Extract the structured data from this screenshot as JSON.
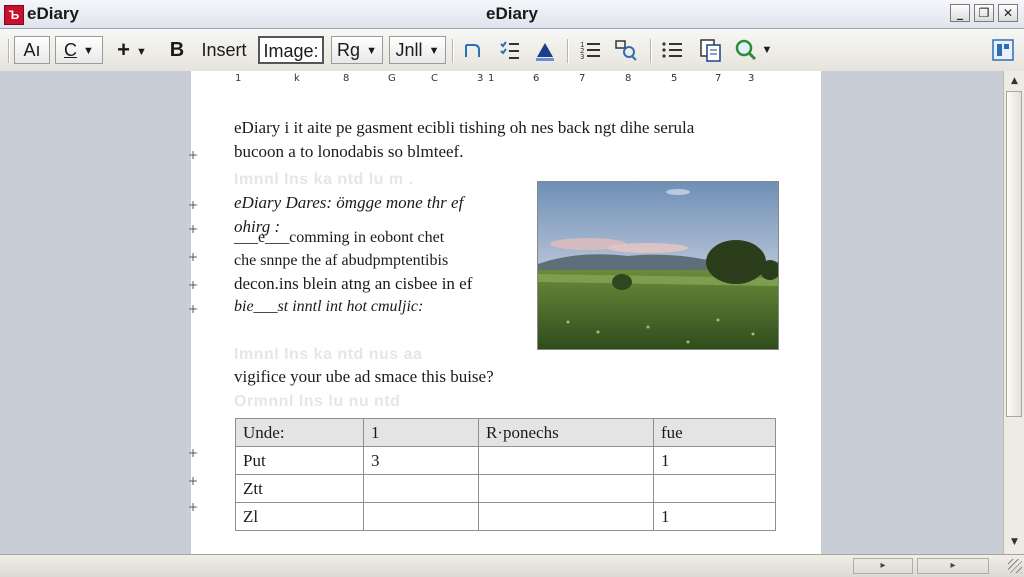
{
  "window": {
    "app_name": "eDiary",
    "title": "eDiary",
    "logo_glyph": "Ъ",
    "minimize": "_",
    "restore": "❐",
    "close": "✕"
  },
  "toolbar": {
    "font_button": "Aı",
    "style_select": "C",
    "add_button": "+",
    "bold_button": "B",
    "insert_label": "Insert",
    "image_button": "Image:",
    "rg_select": "Rg",
    "jnll_select": "Jnll"
  },
  "ruler": [
    "1",
    "k",
    "8",
    "G",
    "C",
    "3",
    "1",
    "6",
    "7",
    "8",
    "5",
    "7",
    "3"
  ],
  "document": {
    "para1_line1": "eDiary i it aite pe gasment ecibli tishing oh nes back ngt dihe serula",
    "para1_line2": "bucoon a to lonodabis so blmteef.",
    "ghost_line1": "Imnnl Ins  ka   ntd  lu m .",
    "para2_line1": "eDiary Dares: ömgge mone thr ef",
    "para2_line2": "ohirg :",
    "para2_line3": "___e___comming in eobont chet",
    "para2_line4": "che snnpe the af abudpmptentibis",
    "para2_line5": "decon.ins blein atng an cisbee in ef",
    "para2_line6": "bie___st inntl int hot cmuljic:",
    "ghost_line2": "Imnnl Ins  ka   ntd   nus  aa",
    "question": "vigifice your ube ad smace this buise?",
    "ghost_line3": "Ormnnl Ins  lu  nu  ntd"
  },
  "table": {
    "headers": [
      "Unde:",
      "1",
      "R·ponechs",
      "fue"
    ],
    "rows": [
      [
        "Put",
        "3",
        "",
        "1"
      ],
      [
        "Ζtt",
        "",
        "",
        ""
      ],
      [
        "Ζl",
        "",
        "",
        "1"
      ]
    ]
  },
  "scrollbar": {
    "up": "▲",
    "down": "▼"
  }
}
